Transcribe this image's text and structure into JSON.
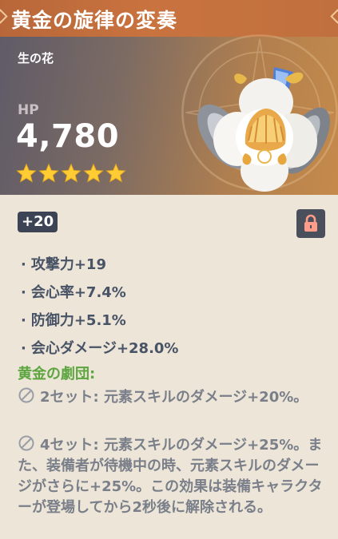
{
  "artifact": {
    "name": "黄金の旋律の変奏",
    "slot": "生の花",
    "main_stat": {
      "label": "HP",
      "value": "4,780"
    },
    "rarity_stars": 5,
    "level": "+20",
    "locked": true,
    "substats": [
      "攻撃力+19",
      "会心率+7.4%",
      "防御力+5.1%",
      "会心ダメージ+28.0%"
    ],
    "set_name": "黄金の劇団:",
    "set_effects": [
      "2セット: 元素スキルのダメージ+20%。",
      "4セット: 元素スキルのダメージ+25%。また、装備者が待機中の時、元素スキルのダメージがさらに+25%。この効果は装備キャラクターが登場してから2秒後に解除される。"
    ]
  },
  "colors": {
    "title_bar": "#c9733f",
    "star": "#ffcc33",
    "set_name": "#5ca53f",
    "substat_text": "#495366",
    "effect_text": "#7a7f89",
    "body_bg": "#ece5d8"
  },
  "icons": {
    "star": "star-icon",
    "lock": "lock-icon",
    "inactive": "prohibited-icon",
    "artifact_art": "flower-of-life-icon"
  }
}
